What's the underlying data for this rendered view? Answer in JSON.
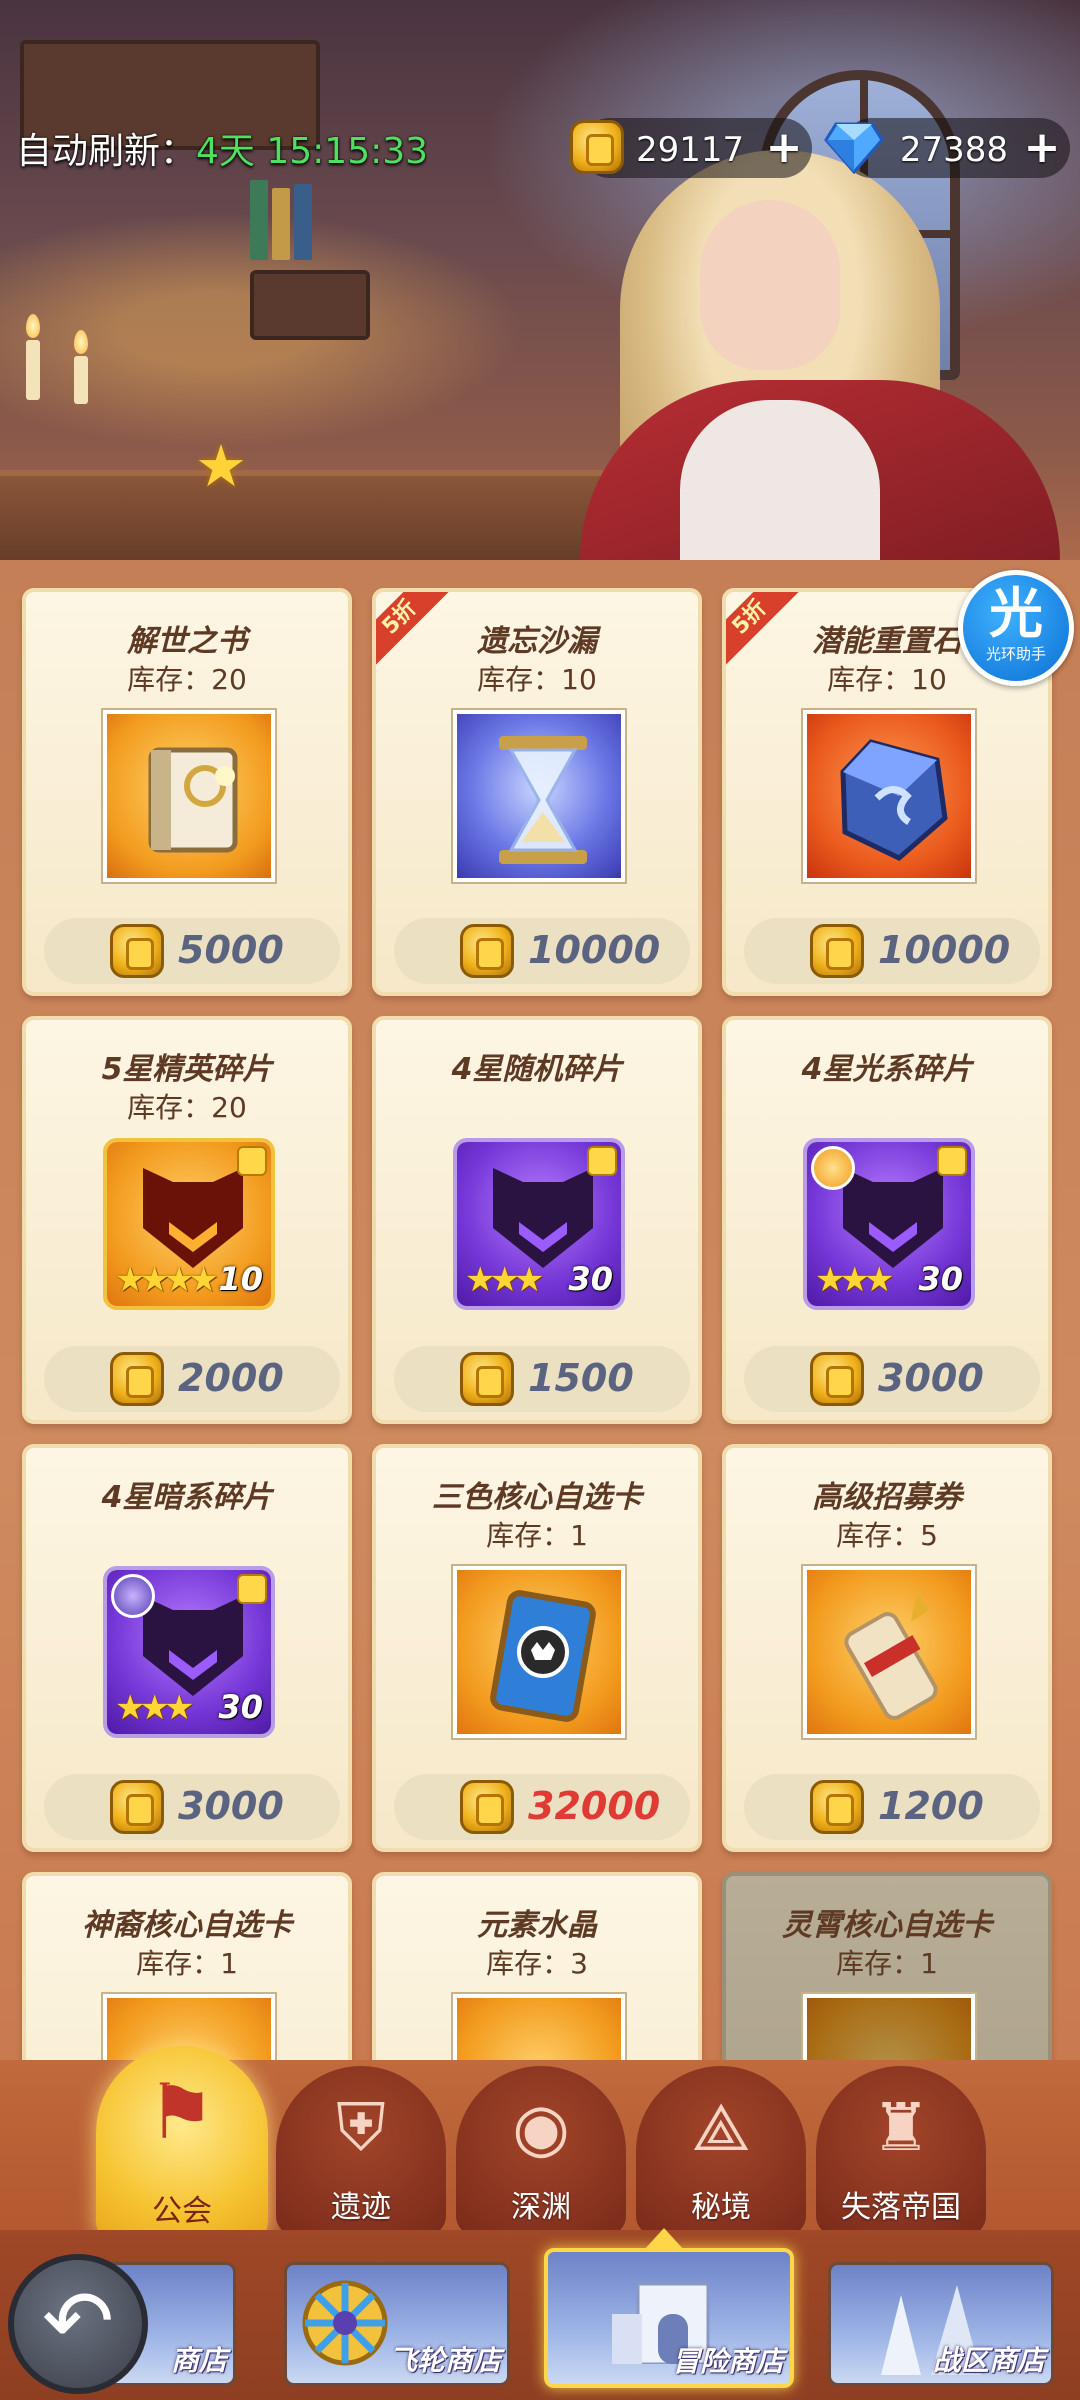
{
  "header": {
    "refresh_label": "自动刷新：",
    "refresh_timer": "4天 15:15:33",
    "gold_amount": "29117",
    "gem_amount": "27388",
    "plus": "+"
  },
  "assistant": {
    "big": "光",
    "small": "光环助手"
  },
  "items": [
    {
      "name": "解世之书",
      "stock": "库存：20",
      "price": "5000",
      "discount": null,
      "art": "gold"
    },
    {
      "name": "遗忘沙漏",
      "stock": "库存：10",
      "price": "10000",
      "discount": "5折",
      "art": "blue"
    },
    {
      "name": "潜能重置石",
      "stock": "库存：10",
      "price": "10000",
      "discount": "5折",
      "art": "red"
    },
    {
      "name": "5星精英碎片",
      "stock": "库存：20",
      "price": "2000",
      "shard_count": "10"
    },
    {
      "name": "4星随机碎片",
      "stock": "",
      "price": "1500",
      "shard_count": "30"
    },
    {
      "name": "4星光系碎片",
      "stock": "",
      "price": "3000",
      "shard_count": "30"
    },
    {
      "name": "4星暗系碎片",
      "stock": "",
      "price": "3000",
      "shard_count": "30"
    },
    {
      "name": "三色核心自选卡",
      "stock": "库存：1",
      "price": "32000",
      "price_color": "#e03a34"
    },
    {
      "name": "高级招募券",
      "stock": "库存：5",
      "price": "1200"
    },
    {
      "name": "神裔核心自选卡",
      "stock": "库存：1"
    },
    {
      "name": "元素水晶",
      "stock": "库存：3"
    },
    {
      "name": "灵霄核心自选卡",
      "stock": "库存：1"
    }
  ],
  "stars": "★★★★",
  "stars3": "★★★",
  "tabs": [
    {
      "label": "公会",
      "icon": "guild-banner-icon",
      "active": true
    },
    {
      "label": "遗迹",
      "icon": "relic-shield-icon"
    },
    {
      "label": "深渊",
      "icon": "abyss-eye-icon"
    },
    {
      "label": "秘境",
      "icon": "secret-realm-icon"
    },
    {
      "label": "失落帝国",
      "icon": "lost-empire-icon"
    }
  ],
  "shops": [
    {
      "label": "商店"
    },
    {
      "label": "飞轮商店"
    },
    {
      "label": "冒险商店",
      "active": true
    },
    {
      "label": "战区商店"
    }
  ],
  "colors": {
    "timer": "#4ee05e",
    "accent": "#ffd64a",
    "price": "#5a6480",
    "price_red": "#e03a34"
  }
}
